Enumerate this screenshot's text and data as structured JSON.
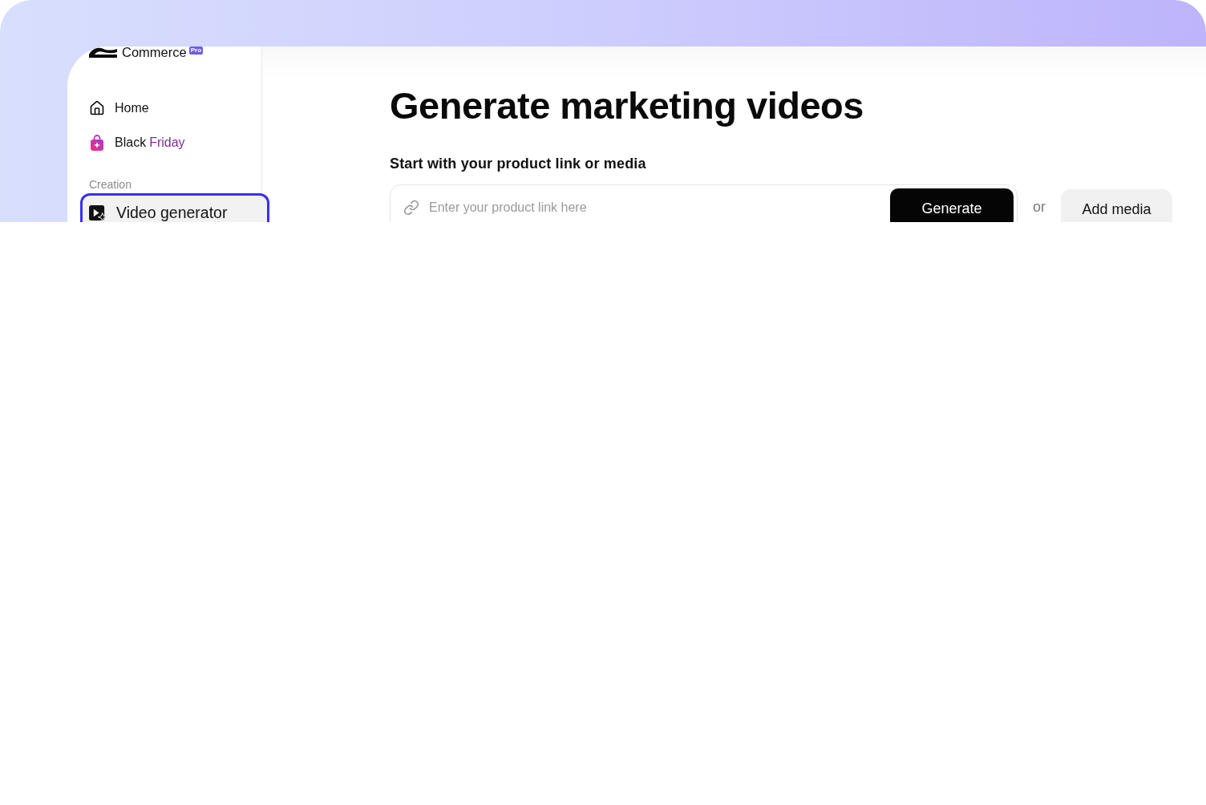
{
  "brand": {
    "name": "Commerce",
    "badge": "Pro"
  },
  "sidebar": {
    "items": [
      {
        "kind": "home",
        "label": "Home",
        "selected": false
      },
      {
        "kind": "promo",
        "label": "Black",
        "highlight": "Friday",
        "selected": false
      }
    ],
    "sections": [
      {
        "title": "Creation",
        "items": [
          {
            "kind": "video",
            "label": "Video generator",
            "selected": true
          }
        ]
      }
    ]
  },
  "main": {
    "title": "Generate marketing videos",
    "subtitle": "Start with your product link or media",
    "link_field": {
      "placeholder": "Enter your product link here"
    },
    "generate_button": "Generate",
    "separator": "or",
    "media_button": "Add media"
  }
}
